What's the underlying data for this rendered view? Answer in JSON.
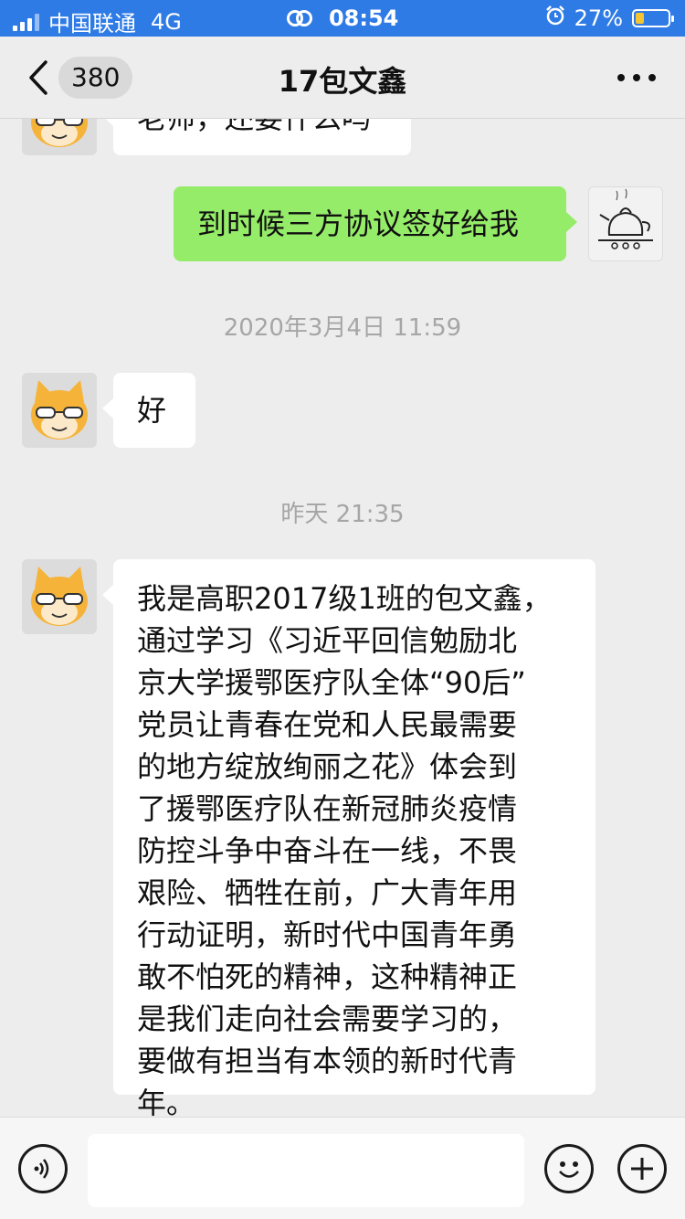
{
  "status_bar": {
    "carrier": "中国联通",
    "network": "4G",
    "time": "08:54",
    "battery": "27%",
    "battery_level": 0.27
  },
  "nav": {
    "back_icon": "chevron-left-icon",
    "unread_count": "380",
    "title": "17包文鑫",
    "more_icon": "more-dots-icon"
  },
  "messages": [
    {
      "side": "left",
      "avatar": "dog-avatar",
      "text": "老师，还要什么吗"
    },
    {
      "side": "right",
      "avatar": "kettle-avatar",
      "text": "到时候三方协议签好给我"
    },
    {
      "timestamp": "2020年3月4日 11:59"
    },
    {
      "side": "left",
      "avatar": "dog-avatar",
      "text": "好"
    },
    {
      "timestamp": "昨天 21:35"
    },
    {
      "side": "left",
      "avatar": "dog-avatar",
      "lines": [
        "我是高职2017级1班的包文鑫，",
        "通过学习《习近平回信勉励北",
        "京大学援鄂医疗队全体“90后”",
        "党员让青春在党和人民最需要",
        "的地方绽放绚丽之花》体会到",
        "了援鄂医疗队在新冠肺炎疫情",
        "防控斗争中奋斗在一线，不畏",
        "艰险、牺牲在前，广大青年用",
        "行动证明，新时代中国青年勇",
        "敢不怕死的精神，这种精神正",
        "是我们走向社会需要学习的，",
        "要做有担当有本领的新时代青",
        "年。"
      ]
    }
  ],
  "input_bar": {
    "voice_icon": "voice-icon",
    "emoji_icon": "emoji-icon",
    "plus_icon": "plus-icon"
  },
  "colors": {
    "status_bar_bg": "#2f7be6",
    "background": "#ededed",
    "sent_bubble": "#95ec69",
    "received_bubble": "#ffffff"
  }
}
